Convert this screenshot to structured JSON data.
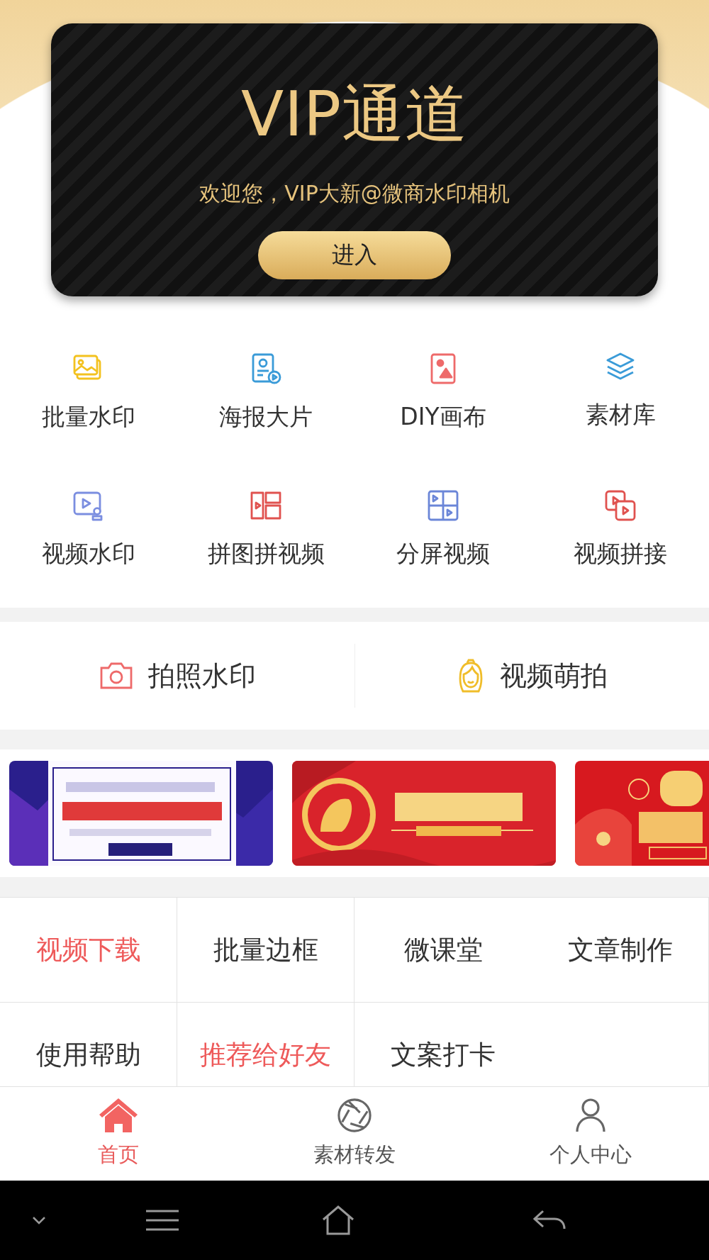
{
  "vip": {
    "title": "VIP通道",
    "welcome": "欢迎您，VIP大新@微商水印相机",
    "button": "进入"
  },
  "features": [
    {
      "label": "批量水印"
    },
    {
      "label": "海报大片"
    },
    {
      "label": "DIY画布"
    },
    {
      "label": "素材库"
    },
    {
      "label": "视频水印"
    },
    {
      "label": "拼图拼视频"
    },
    {
      "label": "分屏视频"
    },
    {
      "label": "视频拼接"
    }
  ],
  "shoot": [
    {
      "label": "拍照水印"
    },
    {
      "label": "视频萌拍"
    }
  ],
  "links": [
    {
      "label": "视频下载",
      "highlighted": true
    },
    {
      "label": "批量边框",
      "highlighted": false
    },
    {
      "label": "微课堂",
      "highlighted": false
    },
    {
      "label": "文章制作",
      "highlighted": false
    },
    {
      "label": "使用帮助",
      "highlighted": false
    },
    {
      "label": "推荐给好友",
      "highlighted": true
    },
    {
      "label": "文案打卡",
      "highlighted": false
    }
  ],
  "tabs": [
    {
      "label": "首页",
      "selected": true
    },
    {
      "label": "素材转发",
      "selected": false
    },
    {
      "label": "个人中心",
      "selected": false
    }
  ]
}
